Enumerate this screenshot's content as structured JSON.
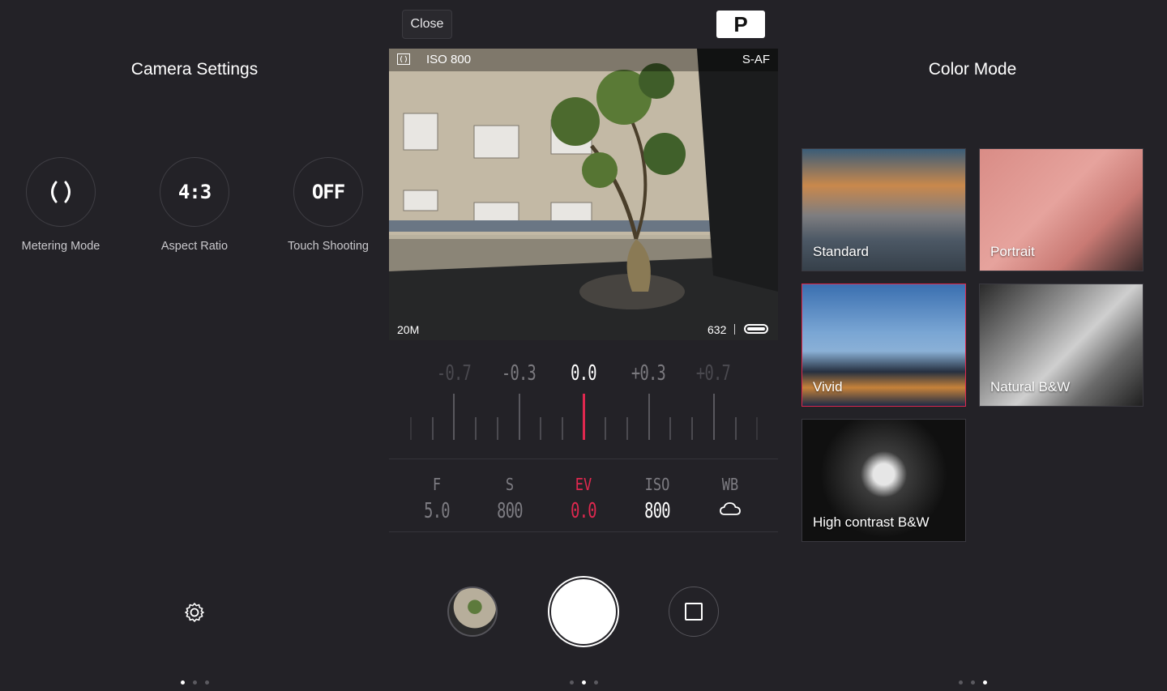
{
  "left_panel": {
    "title": "Camera Settings",
    "settings": [
      {
        "id": "metering",
        "value": "()",
        "label": "Metering Mode"
      },
      {
        "id": "aspect",
        "value": "4:3",
        "label": "Aspect Ratio"
      },
      {
        "id": "touch",
        "value": "OFF",
        "label": "Touch Shooting"
      }
    ]
  },
  "top_bar": {
    "close_label": "Close",
    "mode_label": "P"
  },
  "viewfinder": {
    "iso": "ISO 800",
    "focus": "S-AF",
    "resolution": "20M",
    "shots_remaining": "632"
  },
  "ev_dial": {
    "labels": [
      "-0.7",
      "-0.3",
      "0.0",
      "+0.3",
      "+0.7"
    ],
    "current": "0.0"
  },
  "params": [
    {
      "name": "F",
      "value": "5.0"
    },
    {
      "name": "S",
      "value": "800"
    },
    {
      "name": "EV",
      "value": "0.0"
    },
    {
      "name": "ISO",
      "value": "800"
    },
    {
      "name": "WB",
      "icon": "cloud-icon"
    }
  ],
  "right_panel": {
    "title": "Color Mode",
    "modes": [
      "Standard",
      "Portrait",
      "Vivid",
      "Natural B&W",
      "High contrast B&W"
    ],
    "selected": "Vivid"
  },
  "colors": {
    "accent": "#e0284f",
    "background": "#232227"
  }
}
